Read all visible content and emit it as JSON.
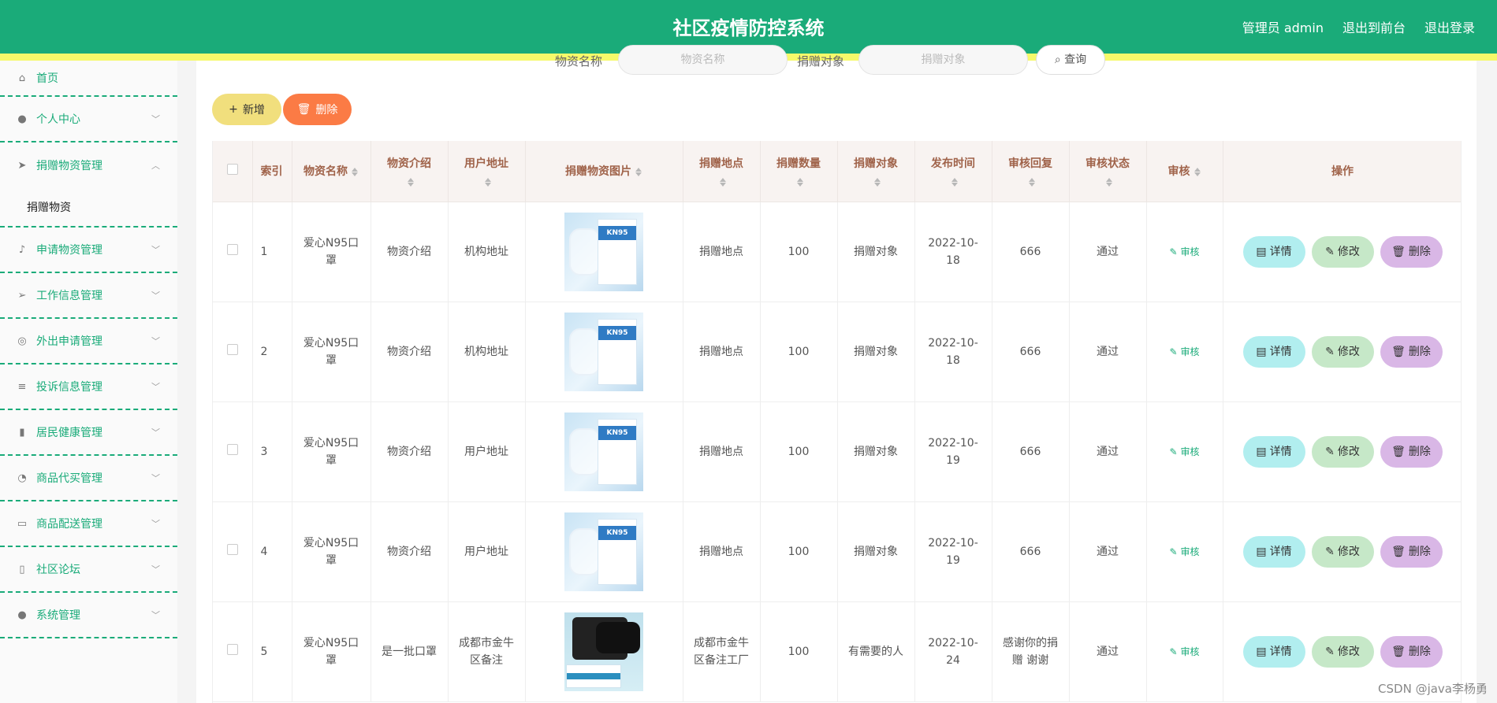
{
  "header": {
    "title": "社区疫情防控系统",
    "links": [
      "管理员 admin",
      "退出到前台",
      "退出登录"
    ]
  },
  "sidebar": {
    "items": [
      {
        "label": "首页",
        "icon": "home-icon"
      },
      {
        "label": "个人中心",
        "icon": "user-icon"
      },
      {
        "label": "捐赠物资管理",
        "icon": "send-icon",
        "expanded": true,
        "children": [
          "捐赠物资"
        ]
      },
      {
        "label": "申请物资管理",
        "icon": "microphone-icon"
      },
      {
        "label": "工作信息管理",
        "icon": "paper-plane-icon"
      },
      {
        "label": "外出申请管理",
        "icon": "lifebuoy-icon"
      },
      {
        "label": "投诉信息管理",
        "icon": "sliders-icon"
      },
      {
        "label": "居民健康管理",
        "icon": "brush-icon"
      },
      {
        "label": "商品代买管理",
        "icon": "speedometer-icon"
      },
      {
        "label": "商品配送管理",
        "icon": "monitor-icon"
      },
      {
        "label": "社区论坛",
        "icon": "mobile-icon"
      },
      {
        "label": "系统管理",
        "icon": "user-icon"
      }
    ]
  },
  "search": {
    "name_label": "物资名称",
    "name_placeholder": "物资名称",
    "target_label": "捐赠对象",
    "target_placeholder": "捐赠对象",
    "button": "查询"
  },
  "toolbar": {
    "add": "新增",
    "delete": "删除"
  },
  "table": {
    "headers": [
      "索引",
      "物资名称",
      "物资介绍",
      "用户地址",
      "捐赠物资图片",
      "捐赠地点",
      "捐赠数量",
      "捐赠对象",
      "发布时间",
      "审核回复",
      "审核状态",
      "审核",
      "操作"
    ],
    "review_label": "审核",
    "actions": {
      "detail": "详情",
      "edit": "修改",
      "delete": "删除"
    },
    "rows": [
      {
        "index": "1",
        "name": "爱心N95口罩",
        "intro": "物资介绍",
        "address": "机构地址",
        "image": "kn95",
        "location": "捐赠地点",
        "quantity": "100",
        "target": "捐赠对象",
        "time": "2022-10-18",
        "reply": "666",
        "status": "通过"
      },
      {
        "index": "2",
        "name": "爱心N95口罩",
        "intro": "物资介绍",
        "address": "机构地址",
        "image": "kn95",
        "location": "捐赠地点",
        "quantity": "100",
        "target": "捐赠对象",
        "time": "2022-10-18",
        "reply": "666",
        "status": "通过"
      },
      {
        "index": "3",
        "name": "爱心N95口罩",
        "intro": "物资介绍",
        "address": "用户地址",
        "image": "kn95",
        "location": "捐赠地点",
        "quantity": "100",
        "target": "捐赠对象",
        "time": "2022-10-19",
        "reply": "666",
        "status": "通过"
      },
      {
        "index": "4",
        "name": "爱心N95口罩",
        "intro": "物资介绍",
        "address": "用户地址",
        "image": "kn95",
        "location": "捐赠地点",
        "quantity": "100",
        "target": "捐赠对象",
        "time": "2022-10-19",
        "reply": "666",
        "status": "通过"
      },
      {
        "index": "5",
        "name": "爱心N95口罩",
        "intro": "是一批口罩",
        "address": "成都市金牛区备注",
        "image": "black-mask",
        "location": "成都市金牛区备注工厂",
        "quantity": "100",
        "target": "有需要的人",
        "time": "2022-10-24",
        "reply": "感谢你的捐赠 谢谢",
        "status": "通过"
      }
    ]
  },
  "image_text": {
    "kn95": "KN95"
  },
  "watermark": "CSDN @java李杨勇",
  "colors": {
    "primary": "#1aab79",
    "stripe": "#f6f96a",
    "add": "#f1df7d",
    "delete": "#fb7b45",
    "detail": "#b1eeef",
    "edit": "#c6e8c8",
    "op_delete": "#d9b7e6",
    "header_text": "#a0634a"
  }
}
